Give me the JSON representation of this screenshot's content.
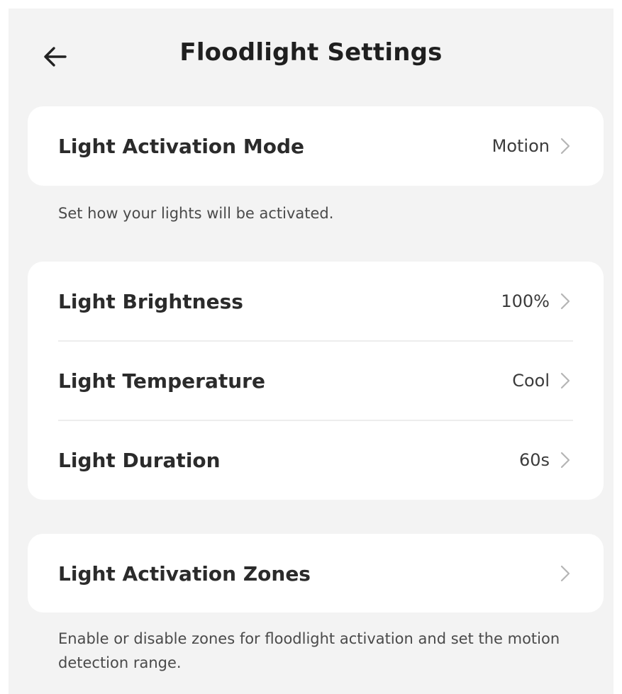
{
  "header": {
    "title": "Floodlight Settings",
    "back_icon": "arrow-left-icon"
  },
  "sections": {
    "activation_mode": {
      "label": "Light Activation Mode",
      "value": "Motion",
      "hint": "Set how your lights will be activated."
    },
    "light": {
      "brightness": {
        "label": "Light Brightness",
        "value": "100%"
      },
      "temperature": {
        "label": "Light Temperature",
        "value": "Cool"
      },
      "duration": {
        "label": "Light Duration",
        "value": "60s"
      }
    },
    "zones": {
      "label": "Light Activation Zones",
      "hint": "Enable or disable zones for floodlight activation and set the motion detection range."
    }
  },
  "icons": {
    "chevron": "chevron-right-icon"
  },
  "colors": {
    "background": "#f3f3f3",
    "card": "#ffffff",
    "text_primary": "#2b2b2b",
    "text_secondary": "#4a4a4a",
    "chevron": "#b5b5b5"
  }
}
